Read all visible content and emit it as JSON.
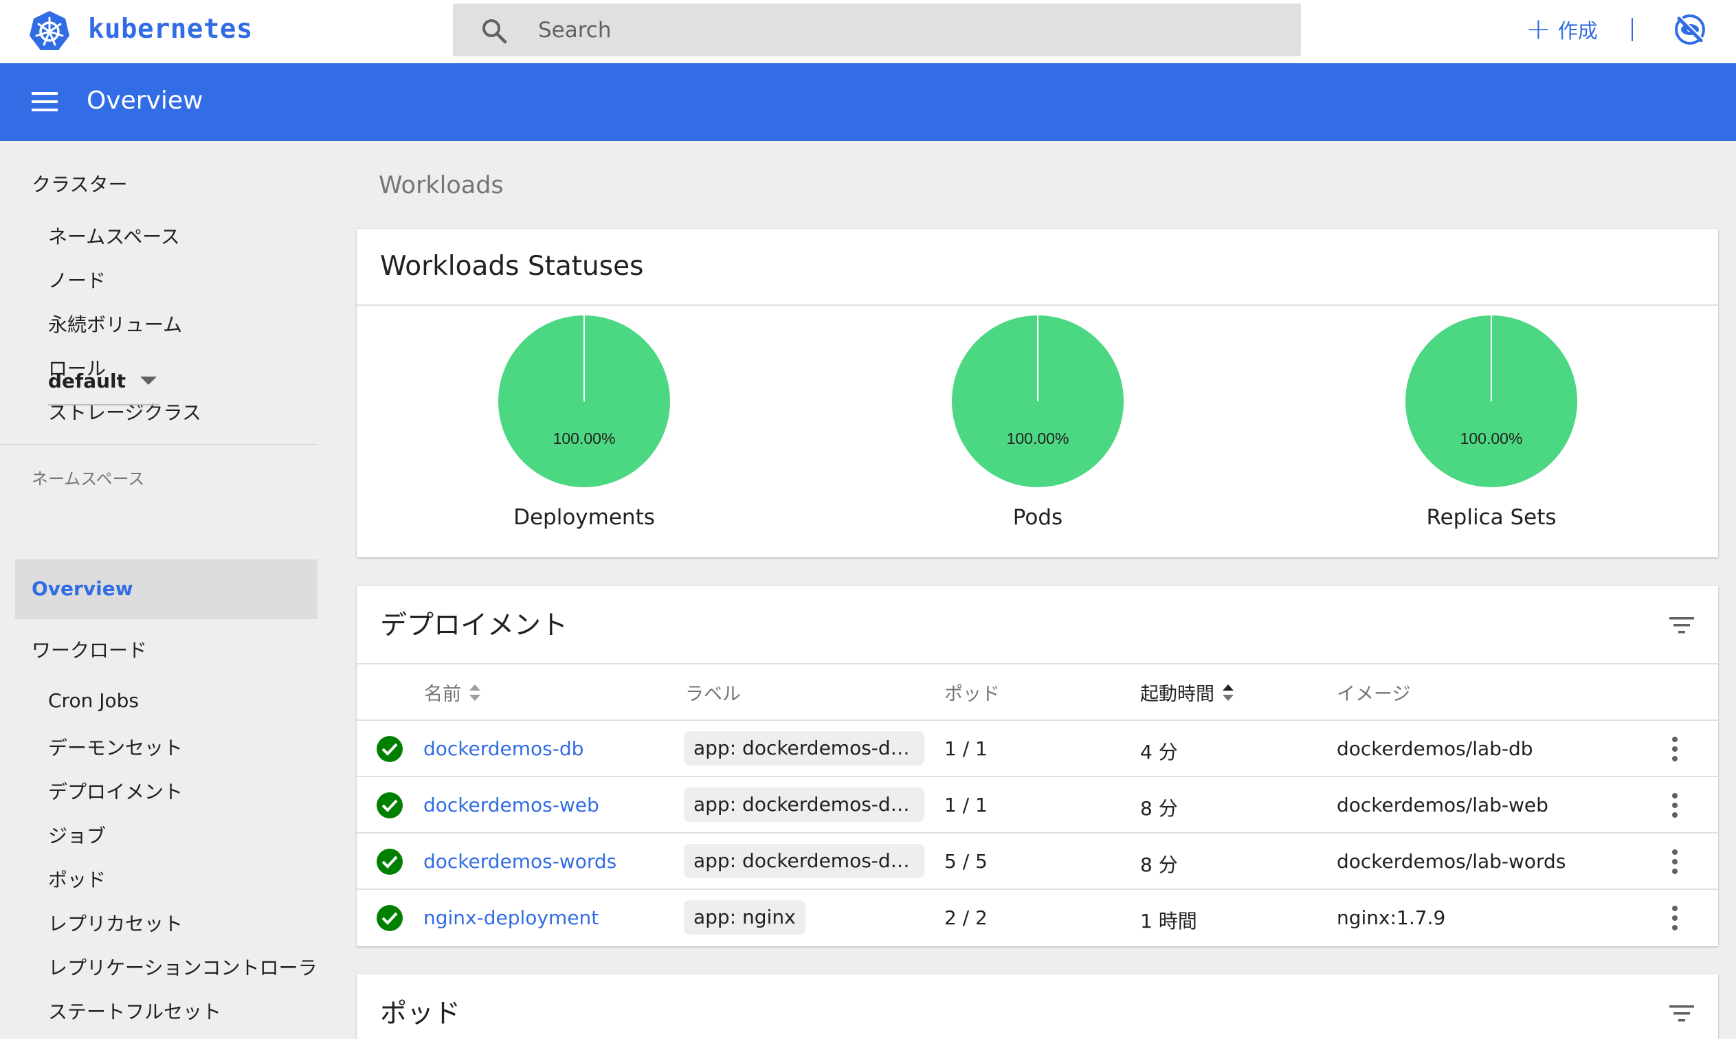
{
  "brand": {
    "name": "kubernetes"
  },
  "search": {
    "placeholder": "Search"
  },
  "topbar": {
    "create_label": "作成"
  },
  "appbar": {
    "title": "Overview"
  },
  "sidebar": {
    "cluster_header": "クラスター",
    "cluster_items": [
      "ネームスペース",
      "ノード",
      "永続ボリューム",
      "ロール",
      "ストレージクラス"
    ],
    "namespace_label": "ネームスペース",
    "namespace_value": "default",
    "active_item": "Overview",
    "workload_header": "ワークロード",
    "workload_items": [
      "Cron Jobs",
      "デーモンセット",
      "デプロイメント",
      "ジョブ",
      "ポッド",
      "レプリカセット",
      "レプリケーションコントローラ",
      "ステートフルセット"
    ]
  },
  "main": {
    "heading": "Workloads",
    "statuses": {
      "title": "Workloads Statuses",
      "charts": [
        {
          "label": "Deployments",
          "percent_text": "100.00%",
          "running_fraction": 1.0,
          "color": "#4cd782"
        },
        {
          "label": "Pods",
          "percent_text": "100.00%",
          "running_fraction": 1.0,
          "color": "#4cd782"
        },
        {
          "label": "Replica Sets",
          "percent_text": "100.00%",
          "running_fraction": 1.0,
          "color": "#4cd782"
        }
      ]
    },
    "deployments": {
      "title": "デプロイメント",
      "columns": {
        "name": "名前",
        "labels": "ラベル",
        "pods": "ポッド",
        "age": "起動時間",
        "images": "イメージ"
      },
      "rows": [
        {
          "name": "dockerdemos-db",
          "label": "app: dockerdemos-deplo…",
          "pods": "1 / 1",
          "age": "4 分",
          "image": "dockerdemos/lab-db"
        },
        {
          "name": "dockerdemos-web",
          "label": "app: dockerdemos-deplo…",
          "pods": "1 / 1",
          "age": "8 分",
          "image": "dockerdemos/lab-web"
        },
        {
          "name": "dockerdemos-words",
          "label": "app: dockerdemos-deplo…",
          "pods": "5 / 5",
          "age": "8 分",
          "image": "dockerdemos/lab-words"
        },
        {
          "name": "nginx-deployment",
          "label": "app: nginx",
          "pods": "2 / 2",
          "age": "1 時間",
          "image": "nginx:1.7.9"
        }
      ]
    },
    "pods": {
      "title": "ポッド"
    }
  },
  "colors": {
    "accent": "#326ce5",
    "appbar": "#326de6",
    "success": "#008000",
    "pie": "#4cd782"
  }
}
